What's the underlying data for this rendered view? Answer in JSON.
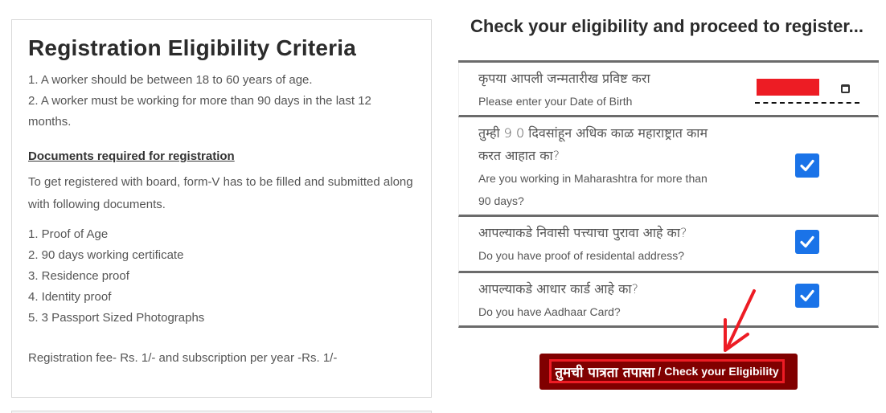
{
  "criteria_panel": {
    "title": "Registration Eligibility Criteria",
    "criteria": [
      "1. A worker should be between 18 to 60 years of age.",
      "2. A worker must be working for more than 90 days in the last 12 months."
    ],
    "documents_title": "Documents required for registration",
    "documents_intro": "To get registered with board, form-V has to be filled and submitted along with following documents.",
    "documents": [
      "1. Proof of Age",
      "2. 90 days working certificate",
      "3. Residence proof",
      "4. Identity proof",
      "5. 3 Passport Sized Photographs"
    ],
    "fee": "Registration fee- Rs. 1/- and subscription per year -Rs. 1/-"
  },
  "eligibility": {
    "title": "Check your eligibility and proceed to register...",
    "questions": [
      {
        "marathi": "कृपया आपली जन्मतारीख प्रविष्ट करा",
        "english": "Please enter your Date of Birth",
        "type": "date",
        "value_redacted": true,
        "redaction_color": "#ed1c24"
      },
      {
        "marathi": "तुम्ही 9 0 दिवसांहून अधिक काळ महाराष्ट्रात काम करत आहात का?",
        "english": "Are you working in Maharashtra for more than 90 days?",
        "type": "checkbox",
        "checked": true
      },
      {
        "marathi": "आपल्याकडे निवासी पत्त्याचा पुरावा आहे का?",
        "english": "Do you have proof of residental address?",
        "type": "checkbox",
        "checked": true
      },
      {
        "marathi": "आपल्याकडे आधार कार्ड आहे का?",
        "english": "Do you have Aadhaar Card?",
        "type": "checkbox",
        "checked": true
      }
    ],
    "submit_button": {
      "marathi": "तुमची पात्रता तपासा",
      "separator": "/",
      "english": "Check your Eligibility"
    }
  },
  "annotation": {
    "arrow_color": "#ed1c24",
    "highlight_color": "#ed1c24"
  },
  "colors": {
    "checkbox": "#1a73e8",
    "button_bg": "#800000"
  }
}
